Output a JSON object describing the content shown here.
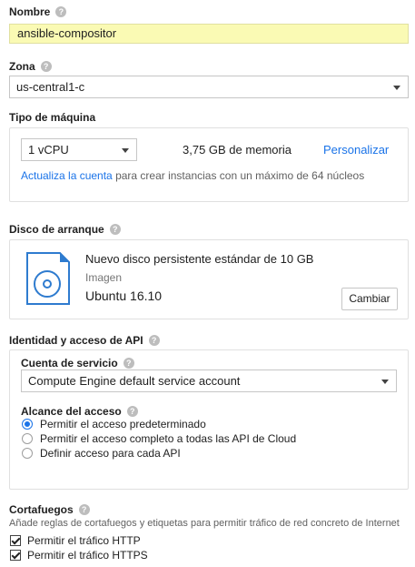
{
  "name": {
    "label": "Nombre",
    "value": "ansible-compositor"
  },
  "zone": {
    "label": "Zona",
    "value": "us-central1-c"
  },
  "machine": {
    "label": "Tipo de máquina",
    "cpu": "1 vCPU",
    "memory": "3,75 GB de memoria",
    "customize": "Personalizar",
    "upgrade_link": "Actualiza la cuenta",
    "upgrade_text": " para crear instancias con un máximo de 64 núcleos"
  },
  "boot_disk": {
    "label": "Disco de arranque",
    "description": "Nuevo disco persistente estándar de 10 GB",
    "image_label": "Imagen",
    "image": "Ubuntu 16.10",
    "change_button": "Cambiar"
  },
  "identity": {
    "label": "Identidad y acceso de API",
    "service_account_label": "Cuenta de servicio",
    "service_account": "Compute Engine default service account",
    "scope_label": "Alcance del acceso",
    "scopes": [
      "Permitir el acceso predeterminado",
      "Permitir el acceso completo a todas las API de Cloud",
      "Definir acceso para cada API"
    ],
    "selected_scope": 0
  },
  "firewall": {
    "label": "Cortafuegos",
    "description": "Añade reglas de cortafuegos y etiquetas para permitir tráfico de red concreto de Internet",
    "options": [
      "Permitir el tráfico HTTP",
      "Permitir el tráfico HTTPS"
    ],
    "checked": [
      true,
      true
    ]
  },
  "colors": {
    "accent": "#1a73e8",
    "name_field_bg": "#fafab4"
  }
}
